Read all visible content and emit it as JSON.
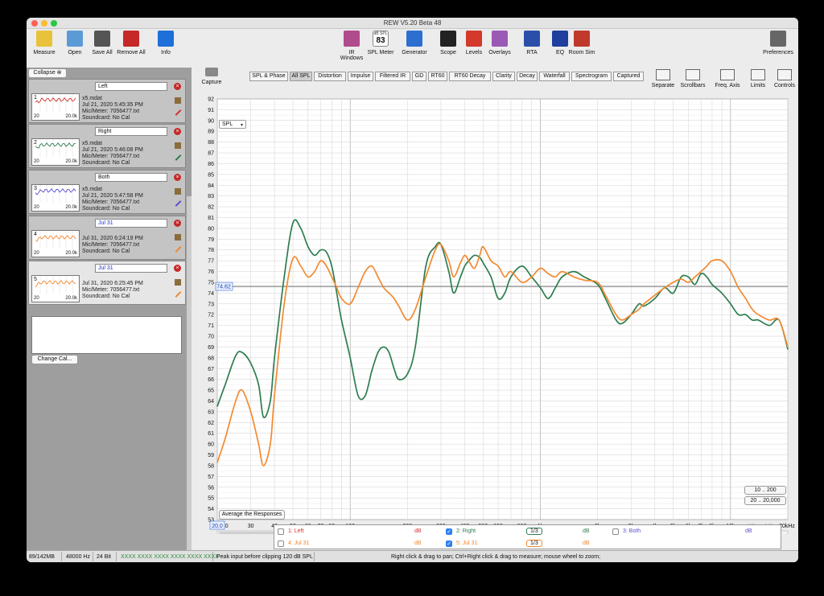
{
  "window": {
    "title": "REW V5.20 Beta 48"
  },
  "toolbar": [
    {
      "label": "Measure",
      "icon": "measure-icon",
      "color": "#e8c23a"
    },
    {
      "label": "Open",
      "icon": "folder-icon",
      "color": "#5b9bd5"
    },
    {
      "label": "Save All",
      "icon": "save-icon",
      "color": "#555555"
    },
    {
      "label": "Remove All",
      "icon": "remove-all-icon",
      "color": "#c62828"
    },
    {
      "label": "Info",
      "icon": "info-icon",
      "color": "#1e6fd9"
    },
    {
      "label": "IR Windows",
      "icon": "ir-windows-icon",
      "color": "#b04b8c"
    },
    {
      "label": "SPL Meter",
      "icon": "spl-meter-icon",
      "color": "#333333"
    },
    {
      "label": "Generator",
      "icon": "generator-icon",
      "color": "#2c6fd1"
    },
    {
      "label": "Scope",
      "icon": "scope-icon",
      "color": "#222222"
    },
    {
      "label": "Levels",
      "icon": "levels-icon",
      "color": "#d33a2c"
    },
    {
      "label": "Overlays",
      "icon": "overlays-icon",
      "color": "#9b59b6"
    },
    {
      "label": "RTA",
      "icon": "rta-icon",
      "color": "#2a4fa8"
    },
    {
      "label": "EQ",
      "icon": "eq-icon",
      "color": "#1e3f9e"
    },
    {
      "label": "Room Sim",
      "icon": "room-sim-icon",
      "color": "#c0392b"
    },
    {
      "label": "Preferences",
      "icon": "wrench-icon",
      "color": "#666666"
    }
  ],
  "spl_meter_value": "83",
  "spl_meter_caption": "dB SPL",
  "left_panel": {
    "collapse_label": "Collapse",
    "change_cal_label": "Change Cal...",
    "measurements": [
      {
        "num": "1",
        "name": "Left",
        "file": "x5.mdat",
        "date": "Jul 21, 2020 5:45:35 PM",
        "mic": "Mic/Meter: 7056477.txt",
        "sound": "Soundcard: No Cal",
        "color": "#d32f2f",
        "axis_lo": "20",
        "axis_hi": "20.0k"
      },
      {
        "num": "2",
        "name": "Right",
        "file": "x5.mdat",
        "date": "Jul 21, 2020 5:46:08 PM",
        "mic": "Mic/Meter: 7056477.txt",
        "sound": "Soundcard: No Cal",
        "color": "#2e7d4f",
        "axis_lo": "20",
        "axis_hi": "20.0k"
      },
      {
        "num": "3",
        "name": "Both",
        "file": "x5.mdat",
        "date": "Jul 21, 2020 5:47:58 PM",
        "mic": "Mic/Meter: 7056477.txt",
        "sound": "Soundcard: No Cal",
        "color": "#5b4fcf",
        "axis_lo": "20",
        "axis_hi": "20.0k"
      },
      {
        "num": "4",
        "name": "Jul 31",
        "file": "",
        "date": "Jul 31, 2020 6:24:19 PM",
        "mic": "Mic/Meter: 7056477.txt",
        "sound": "Soundcard: No Cal",
        "color": "#f0872e",
        "axis_lo": "20",
        "axis_hi": "20.0k"
      },
      {
        "num": "5",
        "name": "Jul 31",
        "file": "",
        "date": "Jul 31, 2020 6:25:45 PM",
        "mic": "Mic/Meter: 7056477.txt",
        "sound": "Soundcard: No Cal",
        "color": "#f0872e",
        "axis_lo": "20",
        "axis_hi": "20.0k"
      }
    ]
  },
  "graph": {
    "capture_label": "Capture",
    "tabs": [
      "SPL & Phase",
      "All SPL",
      "Distortion",
      "Impulse",
      "Filtered IR",
      "GD",
      "RT60",
      "RT60 Decay",
      "Clarity",
      "Decay",
      "Waterfall",
      "Spectrogram",
      "Captured"
    ],
    "active_tab": "All SPL",
    "right_tools": [
      {
        "label": "Separate",
        "icon": "separate-icon"
      },
      {
        "label": "Scrollbars",
        "icon": "scrollbars-icon"
      },
      {
        "label": "Freq. Axis",
        "icon": "freq-axis-icon"
      },
      {
        "label": "Limits",
        "icon": "limits-icon"
      },
      {
        "label": "Controls",
        "icon": "controls-icon"
      }
    ],
    "unit_select": "SPL",
    "y_title": "SPL",
    "cursor_value": "74.62",
    "cursor_freq": "20.0",
    "average_button": "Average the Responses",
    "zoom_buttons": [
      "10 .. 200",
      "20 .. 20,000"
    ]
  },
  "chart_data": {
    "type": "line",
    "title": "",
    "xlabel": "",
    "ylabel": "SPL",
    "xscale": "log",
    "xlim": [
      20,
      20000
    ],
    "ylim": [
      53,
      92
    ],
    "x_tick_labels": [
      "20.0",
      "30",
      "40",
      "50",
      "60",
      "70",
      "80",
      "100",
      "200",
      "300",
      "400",
      "500",
      "600",
      "800",
      "1k",
      "2k",
      "3k",
      "4k",
      "5k",
      "6k",
      "7k",
      "8k",
      "10k",
      "13k",
      "16k",
      "20kHz"
    ],
    "y_tick_labels": [
      "92",
      "91",
      "90",
      "89",
      "88",
      "87",
      "86",
      "85",
      "84",
      "83",
      "82",
      "81",
      "80",
      "79",
      "78",
      "77",
      "76",
      "75",
      "74",
      "73",
      "72",
      "71",
      "70",
      "69",
      "68",
      "67",
      "66",
      "65",
      "64",
      "63",
      "62",
      "61",
      "60",
      "59",
      "58",
      "57",
      "56",
      "55",
      "54",
      "53"
    ],
    "grid": true,
    "legend_position": "bottom",
    "series": [
      {
        "name": "2: Right",
        "color": "#2e7d4f",
        "x": [
          20,
          22,
          25,
          27,
          30,
          33,
          35,
          38,
          40,
          45,
          50,
          55,
          60,
          65,
          70,
          75,
          80,
          85,
          90,
          100,
          110,
          120,
          130,
          140,
          150,
          160,
          170,
          180,
          200,
          220,
          250,
          280,
          300,
          330,
          350,
          380,
          400,
          420,
          450,
          480,
          500,
          550,
          600,
          650,
          700,
          800,
          900,
          1000,
          1100,
          1200,
          1300,
          1500,
          1700,
          2000,
          2200,
          2500,
          2700,
          3000,
          3300,
          3500,
          4000,
          4500,
          5000,
          5500,
          6000,
          6500,
          7000,
          7500,
          8000,
          9000,
          10000,
          11000,
          12000,
          13000,
          14000,
          16000,
          18000,
          20000
        ],
        "y": [
          63.5,
          65.5,
          68.2,
          68.5,
          67.5,
          65.5,
          62.5,
          64,
          68,
          75.5,
          80.5,
          80,
          78.3,
          77.5,
          78,
          77.8,
          76.5,
          74,
          71.5,
          68,
          64.5,
          64.5,
          66.8,
          68.5,
          69,
          68.5,
          67,
          66,
          66.5,
          69,
          76.5,
          78.3,
          78.5,
          76,
          74,
          75.5,
          76.5,
          77,
          77.5,
          77.3,
          76.8,
          75.5,
          73.5,
          74,
          75.5,
          76.5,
          75.5,
          74.5,
          73.5,
          74.5,
          75.5,
          76,
          75.5,
          74.8,
          73.5,
          71.5,
          71.2,
          72,
          73,
          72.8,
          73.5,
          74.5,
          74,
          75.5,
          75.5,
          74.8,
          75.8,
          75.5,
          74.8,
          74,
          73,
          72,
          72,
          71.5,
          71.5,
          71,
          71.5,
          68.8
        ]
      },
      {
        "name": "5: Jul 31",
        "color": "#f28a30",
        "x": [
          20,
          22,
          25,
          27,
          30,
          33,
          35,
          38,
          40,
          45,
          50,
          55,
          60,
          65,
          70,
          75,
          80,
          85,
          90,
          100,
          110,
          120,
          130,
          140,
          150,
          160,
          170,
          180,
          200,
          220,
          250,
          280,
          300,
          330,
          350,
          380,
          400,
          420,
          450,
          480,
          500,
          550,
          600,
          650,
          700,
          800,
          900,
          1000,
          1100,
          1200,
          1300,
          1500,
          1700,
          2000,
          2200,
          2500,
          2700,
          3000,
          3300,
          3500,
          4000,
          4500,
          5000,
          5500,
          6000,
          6500,
          7000,
          7500,
          8000,
          9000,
          10000,
          11000,
          12000,
          13000,
          14000,
          16000,
          18000,
          20000
        ],
        "y": [
          58.3,
          60.5,
          64,
          65,
          63,
          60,
          58,
          60,
          64.5,
          73,
          77.2,
          76.5,
          75.5,
          76,
          77,
          76.5,
          75.5,
          74.5,
          73.5,
          73,
          74.5,
          76,
          76.5,
          75.5,
          74.5,
          74,
          73.5,
          72.8,
          71.5,
          72.5,
          75.5,
          78,
          78.5,
          77,
          75.5,
          76.8,
          77.5,
          77,
          76.3,
          77.5,
          78.3,
          77,
          76.5,
          75.5,
          76,
          75,
          75.5,
          76.3,
          75.8,
          75.5,
          76,
          75.5,
          75.2,
          75,
          73.8,
          72,
          71.5,
          72,
          72.5,
          73,
          73.8,
          74.5,
          75,
          75.3,
          75,
          75.5,
          76,
          76.5,
          77,
          77,
          76,
          74.5,
          73.5,
          72.5,
          72,
          71.5,
          71.5,
          69
        ]
      }
    ]
  },
  "legend": [
    {
      "label": "1: Left",
      "checked": false,
      "color": "#d32f2f",
      "unit": "dB",
      "smoothing": ""
    },
    {
      "label": "2: Right",
      "checked": true,
      "color": "#2e7d4f",
      "unit": "dB",
      "smoothing": "1/3"
    },
    {
      "label": "3: Both",
      "checked": false,
      "color": "#5b4fcf",
      "unit": "dB",
      "smoothing": ""
    },
    {
      "label": "4: Jul 31",
      "checked": false,
      "color": "#f0872e",
      "unit": "dB",
      "smoothing": ""
    },
    {
      "label": "5: Jul 31",
      "checked": true,
      "color": "#f0872e",
      "unit": "dB",
      "smoothing": "1/3"
    }
  ],
  "status": {
    "memory": "89/142MB",
    "rate": "48000 Hz",
    "bits": "24 Bit",
    "clip_meters": "XXXX XXXX  XXXX XXXX  XXXX XXXX",
    "peak": "Peak input before clipping 120 dB SPL",
    "hint": "Right click & drag to pan; Ctrl+Right click & drag to measure; mouse wheel to zoom;"
  }
}
